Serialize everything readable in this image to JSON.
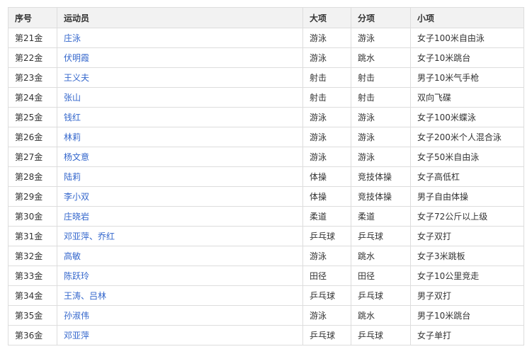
{
  "table": {
    "headers": [
      "序号",
      "运动员",
      "大项",
      "分项",
      "小项"
    ],
    "rows": [
      {
        "no": "第21金",
        "athlete": "庄泳",
        "sport": "游泳",
        "discipline": "游泳",
        "event": "女子100米自由泳"
      },
      {
        "no": "第22金",
        "athlete": "伏明霞",
        "sport": "游泳",
        "discipline": "跳水",
        "event": "女子10米跳台"
      },
      {
        "no": "第23金",
        "athlete": "王义夫",
        "sport": "射击",
        "discipline": "射击",
        "event": "男子10米气手枪"
      },
      {
        "no": "第24金",
        "athlete": "张山",
        "sport": "射击",
        "discipline": "射击",
        "event": "双向飞碟"
      },
      {
        "no": "第25金",
        "athlete": "钱红",
        "sport": "游泳",
        "discipline": "游泳",
        "event": "女子100米蝶泳"
      },
      {
        "no": "第26金",
        "athlete": "林莉",
        "sport": "游泳",
        "discipline": "游泳",
        "event": "女子200米个人混合泳"
      },
      {
        "no": "第27金",
        "athlete": "杨文意",
        "sport": "游泳",
        "discipline": "游泳",
        "event": "女子50米自由泳"
      },
      {
        "no": "第28金",
        "athlete": "陆莉",
        "sport": "体操",
        "discipline": "竞技体操",
        "event": "女子高低杠"
      },
      {
        "no": "第29金",
        "athlete": "李小双",
        "sport": "体操",
        "discipline": "竞技体操",
        "event": "男子自由体操"
      },
      {
        "no": "第30金",
        "athlete": "庄晓岩",
        "sport": "柔道",
        "discipline": "柔道",
        "event": "女子72公斤以上级"
      },
      {
        "no": "第31金",
        "athlete": "邓亚萍、乔红",
        "sport": "乒乓球",
        "discipline": "乒乓球",
        "event": "女子双打"
      },
      {
        "no": "第32金",
        "athlete": "高敏",
        "sport": "游泳",
        "discipline": "跳水",
        "event": "女子3米跳板"
      },
      {
        "no": "第33金",
        "athlete": "陈跃玲",
        "sport": "田径",
        "discipline": "田径",
        "event": "女子10公里竞走"
      },
      {
        "no": "第34金",
        "athlete": "王涛、吕林",
        "sport": "乒乓球",
        "discipline": "乒乓球",
        "event": "男子双打"
      },
      {
        "no": "第35金",
        "athlete": "孙淑伟",
        "sport": "游泳",
        "discipline": "跳水",
        "event": "男子10米跳台"
      },
      {
        "no": "第36金",
        "athlete": "邓亚萍",
        "sport": "乒乓球",
        "discipline": "乒乓球",
        "event": "女子单打"
      }
    ]
  }
}
